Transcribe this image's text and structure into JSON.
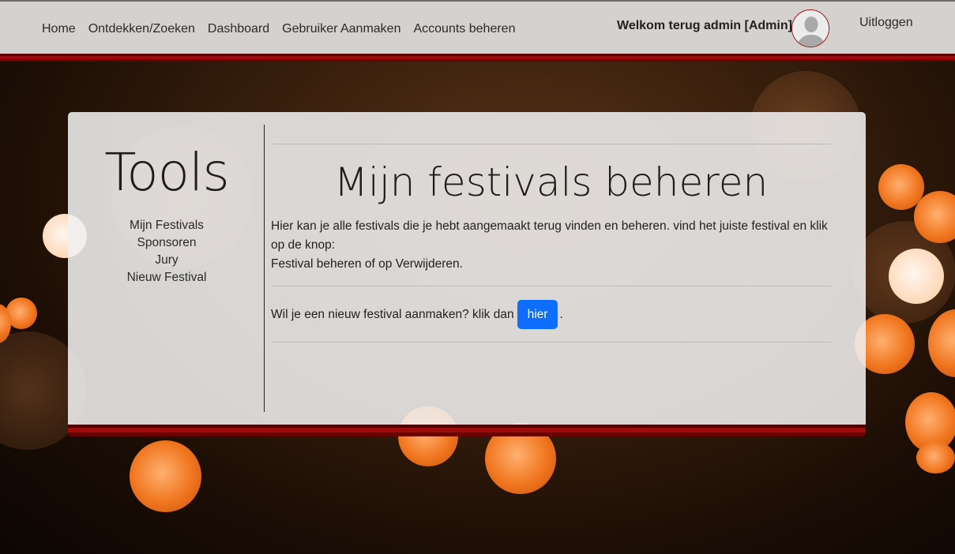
{
  "navbar": {
    "links": [
      "Home",
      "Ontdekken/Zoeken",
      "Dashboard",
      "Gebruiker Aanmaken",
      "Accounts beheren"
    ],
    "welcome": "Welkom terug admin [Admin]",
    "avatar_icon": "user-silhouette-icon",
    "logout": "Uitloggen"
  },
  "sidebar": {
    "title": "Tools",
    "links": [
      "Mijn Festivals",
      "Sponsoren",
      "Jury",
      "Nieuw Festival"
    ]
  },
  "main": {
    "title": "Mijn festivals beheren",
    "description": "Hier kan je alle festivals die je hebt aangemaakt terug vinden en beheren. vind het juiste festival en klik op de knop:",
    "description_line2": "Festival beheren of op Verwijderen.",
    "new_prompt": "Wil je een nieuw festival aanmaken? klik dan",
    "new_button": "hier",
    "new_suffix": "."
  },
  "colors": {
    "navbar_bg": "#d4d1cf",
    "accent_red": "#a0080a",
    "button_blue": "#0d6efd"
  }
}
